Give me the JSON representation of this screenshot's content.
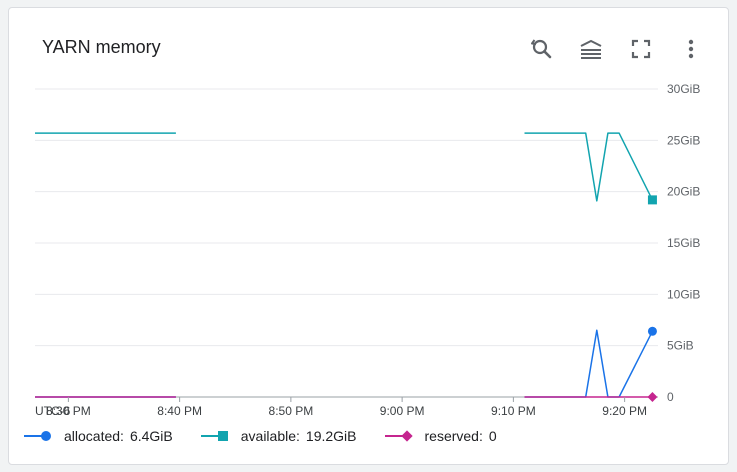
{
  "card": {
    "title": "YARN memory",
    "tools": [
      {
        "icon": "zoom-reset-icon"
      },
      {
        "icon": "legend-toggle-icon"
      },
      {
        "icon": "fullscreen-icon"
      },
      {
        "icon": "more-vert-icon"
      }
    ]
  },
  "timezone": "UTC-6",
  "chart_data": {
    "type": "line",
    "y_ticks": [
      "30GiB",
      "25GiB",
      "20GiB",
      "15GiB",
      "10GiB",
      "5GiB",
      "0"
    ],
    "ylim": [
      0,
      30
    ],
    "y_unit": "GiB",
    "x_ticks": [
      "8:30 PM",
      "8:40 PM",
      "8:50 PM",
      "9:00 PM",
      "9:10 PM",
      "9:20 PM"
    ],
    "xlim": [
      "8:27 PM",
      "9:23 PM"
    ],
    "series": [
      {
        "name": "allocated",
        "color": "#1a73e8",
        "marker": "circle",
        "last_value": "6.4GiB",
        "segments": [
          [
            [
              "8:27 PM",
              0
            ],
            [
              "8:39:40 PM",
              0
            ]
          ],
          [
            [
              "9:11 PM",
              0
            ],
            [
              "9:16:30 PM",
              0
            ],
            [
              "9:17:30 PM",
              6.5
            ],
            [
              "9:18:30 PM",
              0
            ],
            [
              "9:19:30 PM",
              0
            ],
            [
              "9:22:30 PM",
              6.4
            ]
          ]
        ]
      },
      {
        "name": "available",
        "color": "#12a4af",
        "marker": "square",
        "last_value": "19.2GiB",
        "segments": [
          [
            [
              "8:27 PM",
              25.7
            ],
            [
              "8:39:40 PM",
              25.7
            ]
          ],
          [
            [
              "9:11 PM",
              25.7
            ],
            [
              "9:16:30 PM",
              25.7
            ],
            [
              "9:17:30 PM",
              19.1
            ],
            [
              "9:18:30 PM",
              25.7
            ],
            [
              "9:19:30 PM",
              25.7
            ],
            [
              "9:22:30 PM",
              19.2
            ]
          ]
        ]
      },
      {
        "name": "reserved",
        "color": "#c5258f",
        "marker": "diamond",
        "last_value": "0",
        "segments": [
          [
            [
              "8:27 PM",
              0
            ],
            [
              "8:39:40 PM",
              0
            ]
          ],
          [
            [
              "9:11 PM",
              0
            ],
            [
              "9:22:30 PM",
              0
            ]
          ]
        ]
      }
    ]
  },
  "legend": [
    {
      "name": "allocated",
      "sep": ":",
      "value": "6.4GiB",
      "color": "#1a73e8",
      "marker": "circle"
    },
    {
      "name": "available",
      "sep": ":",
      "value": "19.2GiB",
      "color": "#12a4af",
      "marker": "square"
    },
    {
      "name": "reserved",
      "sep": ":",
      "value": "0",
      "color": "#c5258f",
      "marker": "diamond"
    }
  ]
}
